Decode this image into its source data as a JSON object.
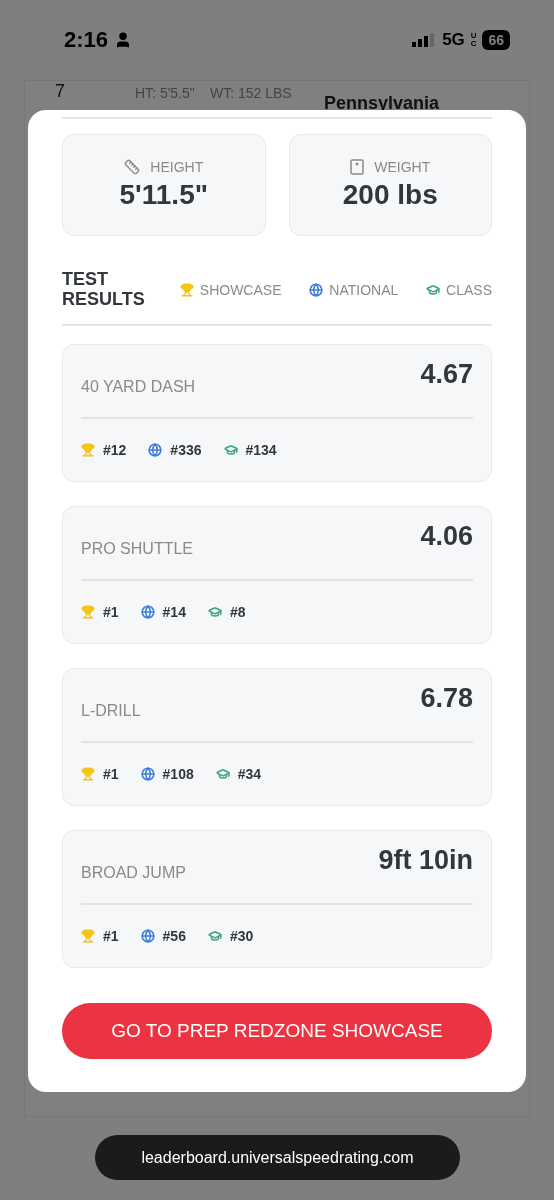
{
  "status_bar": {
    "time": "2:16",
    "network": "5G",
    "network_badge": "UC",
    "battery": "66"
  },
  "background_row": {
    "rank": "7",
    "height": "HT: 5'5.5\"",
    "weight": "WT: 152 LBS",
    "location": "Pennsylvania"
  },
  "modal": {
    "measurements": [
      {
        "kind": "height",
        "label": "HEIGHT",
        "value": "5'11.5\""
      },
      {
        "kind": "weight",
        "label": "WEIGHT",
        "value": "200 lbs"
      }
    ],
    "section_title": "TEST RESULTS",
    "legend": [
      {
        "kind": "showcase",
        "label": "SHOWCASE",
        "color": "#f5c518"
      },
      {
        "kind": "national",
        "label": "NATIONAL",
        "color": "#3b7ddd"
      },
      {
        "kind": "class",
        "label": "CLASS",
        "color": "#3aa57a"
      }
    ],
    "results": [
      {
        "name": "40 YARD DASH",
        "value": "4.67",
        "ranks": [
          "#12",
          "#336",
          "#134"
        ]
      },
      {
        "name": "PRO SHUTTLE",
        "value": "4.06",
        "ranks": [
          "#1",
          "#14",
          "#8"
        ]
      },
      {
        "name": "L-DRILL",
        "value": "6.78",
        "ranks": [
          "#1",
          "#108",
          "#34"
        ]
      },
      {
        "name": "BROAD JUMP",
        "value": "9ft 10in",
        "ranks": [
          "#1",
          "#56",
          "#30"
        ]
      }
    ],
    "button": "GO TO PREP REDZONE SHOWCASE"
  },
  "url_bar": "leaderboard.universalspeedrating.com"
}
